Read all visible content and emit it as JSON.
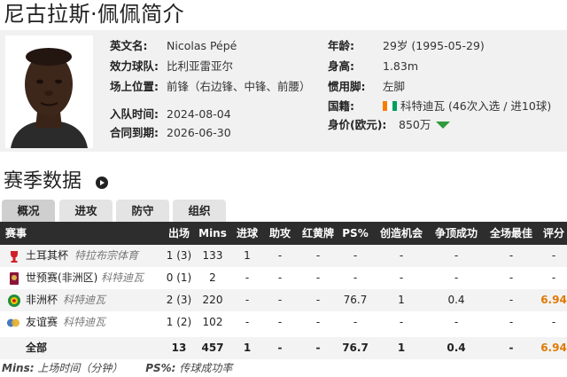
{
  "page_title": "尼古拉斯·佩佩简介",
  "profile": {
    "english_name_label": "英文名:",
    "english_name": "Nicolas Pépé",
    "club_label": "效力球队:",
    "club": "比利亚雷亚尔",
    "position_label": "场上位置:",
    "position": "前锋（右边锋、中锋、前腰）",
    "joined_label": "入队时间:",
    "joined": "2024-08-04",
    "contract_label": "合同到期:",
    "contract": "2026-06-30",
    "age_label": "年龄:",
    "age": "29岁  (1995-05-29)",
    "height_label": "身高:",
    "height": "1.83m",
    "foot_label": "惯用脚:",
    "foot": "左脚",
    "nation_label": "国籍:",
    "nation": "科特迪瓦 (46次入选 / 进10球)",
    "value_label": "身价(欧元):",
    "value": "850万",
    "flag_colors": [
      "#f77f00",
      "#ffffff",
      "#009e60"
    ],
    "trend_icon": "down-arrow-icon",
    "trend_color": "#2e9a3a"
  },
  "season": {
    "title": "赛季数据",
    "tabs": [
      {
        "label": "概况",
        "active": true
      },
      {
        "label": "进攻",
        "active": false
      },
      {
        "label": "防守",
        "active": false
      },
      {
        "label": "组织",
        "active": false
      }
    ],
    "headers": [
      "赛事",
      "出场",
      "Mins",
      "进球",
      "助攻",
      "红黄牌",
      "PS%",
      "创造机会",
      "争顶成功",
      "全场最佳",
      "评分"
    ],
    "rows": [
      {
        "icon": "turkish-cup-icon",
        "competition": "土耳其杯",
        "team": "特拉布宗体育",
        "apps": "1 (3)",
        "mins": "133",
        "goals": "1",
        "assists": "-",
        "cards": "-",
        "ps": "-",
        "chances": "-",
        "aerials": "-",
        "motm": "-",
        "rating": "-"
      },
      {
        "icon": "wc-qualifier-africa-icon",
        "competition": "世预赛(非洲区)",
        "team": "科特迪瓦",
        "apps": "0 (1)",
        "mins": "2",
        "goals": "-",
        "assists": "-",
        "cards": "-",
        "ps": "-",
        "chances": "-",
        "aerials": "-",
        "motm": "-",
        "rating": "-"
      },
      {
        "icon": "afcon-icon",
        "competition": "非洲杯",
        "team": "科特迪瓦",
        "apps": "2 (3)",
        "mins": "220",
        "goals": "-",
        "assists": "-",
        "cards": "-",
        "ps": "76.7",
        "chances": "1",
        "aerials": "0.4",
        "motm": "-",
        "rating": "6.94"
      },
      {
        "icon": "friendly-icon",
        "competition": "友谊赛",
        "team": "科特迪瓦",
        "apps": "1 (2)",
        "mins": "102",
        "goals": "-",
        "assists": "-",
        "cards": "-",
        "ps": "-",
        "chances": "-",
        "aerials": "-",
        "motm": "-",
        "rating": "-"
      }
    ],
    "total": {
      "competition": "全部",
      "apps": "13",
      "mins": "457",
      "goals": "1",
      "assists": "-",
      "cards": "-",
      "ps": "76.7",
      "chances": "1",
      "aerials": "0.4",
      "motm": "-",
      "rating": "6.94"
    },
    "rating_color": "#e07a00"
  },
  "footnote": {
    "mins_key": "Mins:",
    "mins_desc": "上场时间（分钟）",
    "ps_key": "PS%:",
    "ps_desc": "传球成功率"
  }
}
